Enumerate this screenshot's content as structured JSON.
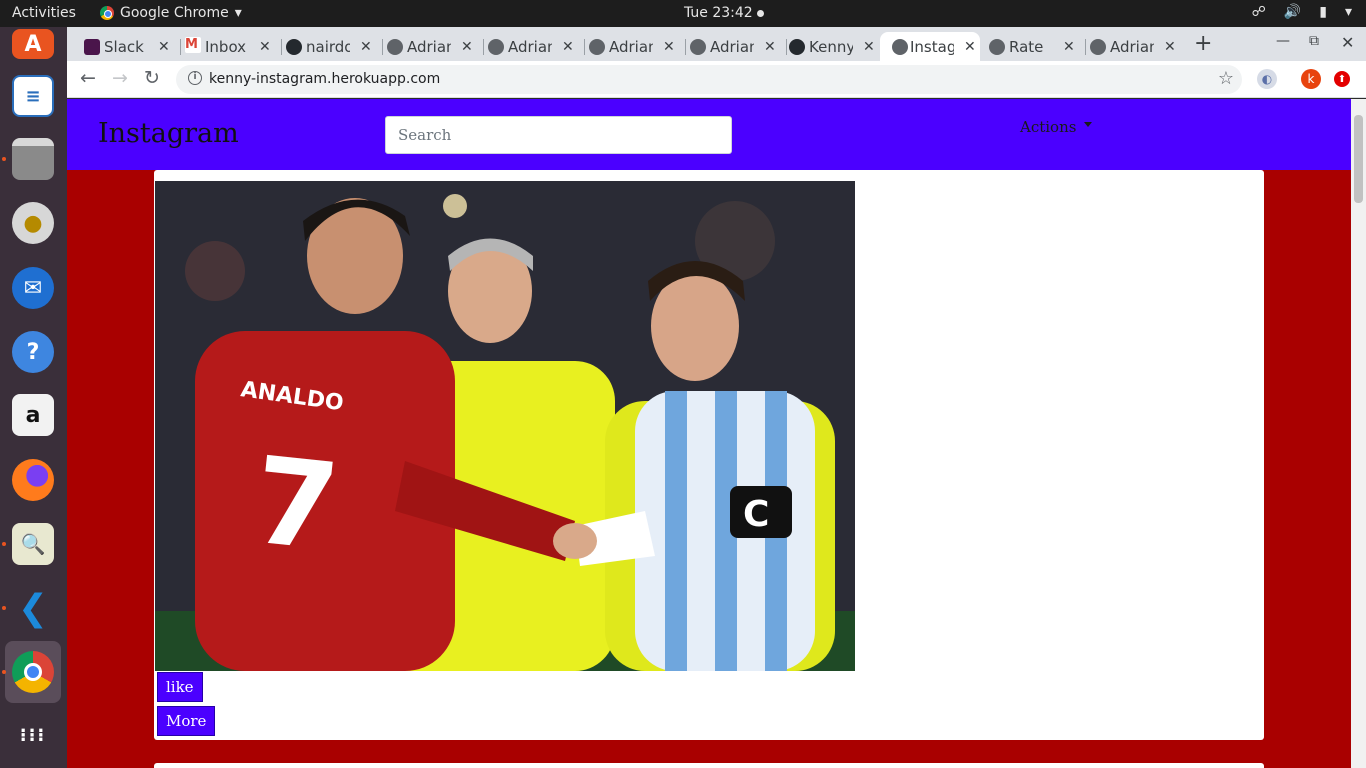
{
  "topbar": {
    "activities": "Activities",
    "app_name": "Google Chrome",
    "clock": "Tue 23:42"
  },
  "dock": [
    {
      "name": "ubuntu-software-icon"
    },
    {
      "name": "libreoffice-writer-icon"
    },
    {
      "name": "files-icon"
    },
    {
      "name": "rhythmbox-icon"
    },
    {
      "name": "thunderbird-icon"
    },
    {
      "name": "help-icon"
    },
    {
      "name": "amazon-icon"
    },
    {
      "name": "firefox-icon"
    },
    {
      "name": "image-viewer-icon"
    },
    {
      "name": "vscode-icon"
    },
    {
      "name": "chrome-icon"
    },
    {
      "name": "show-apps-icon"
    }
  ],
  "tabs": [
    {
      "label": "Slack",
      "icon": "slack-icon",
      "color": "#4a154b"
    },
    {
      "label": "Inbox",
      "icon": "gmail-icon",
      "color": "#db4437"
    },
    {
      "label": "nairdo",
      "icon": "github-icon",
      "color": "#24292e"
    },
    {
      "label": "Adrian",
      "icon": "globe-icon",
      "color": "#5f6368"
    },
    {
      "label": "Adrian",
      "icon": "globe-icon",
      "color": "#5f6368"
    },
    {
      "label": "Adrian",
      "icon": "globe-icon",
      "color": "#5f6368"
    },
    {
      "label": "Adrian",
      "icon": "globe-icon",
      "color": "#5f6368"
    },
    {
      "label": "Kenny",
      "icon": "github-icon",
      "color": "#24292e"
    },
    {
      "label": "Instagram",
      "icon": "globe-icon",
      "color": "#5f6368",
      "active": true
    },
    {
      "label": "Rate",
      "icon": "globe-icon",
      "color": "#5f6368"
    },
    {
      "label": "Adrian",
      "icon": "globe-icon",
      "color": "#5f6368"
    }
  ],
  "omnibox": {
    "url": "kenny-instagram.herokuapp.com"
  },
  "extensions": {
    "profile_letter": "k"
  },
  "page": {
    "brand": "Instagram",
    "search_placeholder": "Search",
    "actions_label": "Actions",
    "post": {
      "like_label": "like",
      "more_label": "More"
    }
  },
  "colors": {
    "navbar": "#4b00ff",
    "page_background": "#a90000",
    "button": "#4b00ff"
  }
}
